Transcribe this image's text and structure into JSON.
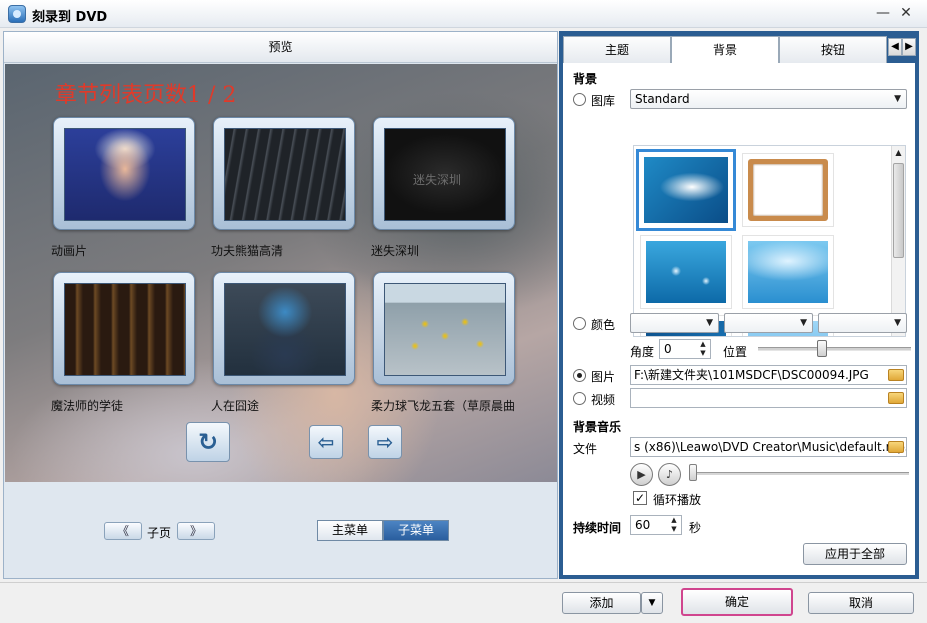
{
  "window": {
    "title": "刻录到 DVD",
    "minimize": "—",
    "close": "✕"
  },
  "preview": {
    "header": "预览",
    "chapter_title": "章节列表页数1 / 2",
    "watermark": "迷失深圳",
    "chapters": [
      {
        "label": "动画片"
      },
      {
        "label": "功夫熊猫高清"
      },
      {
        "label": "迷失深圳"
      },
      {
        "label": "魔法师的学徒"
      },
      {
        "label": "人在囧途"
      },
      {
        "label": "柔力球飞龙五套（草原晨曲"
      }
    ],
    "return_icon": "↻",
    "prev_icon": "⇦",
    "next_icon": "⇨"
  },
  "page_nav": {
    "prev": "《",
    "label": "子页",
    "next": "》"
  },
  "menu_switch": {
    "main": "主菜单",
    "sub": "子菜单"
  },
  "tabs": {
    "items": [
      "主题",
      "背景",
      "按钮"
    ],
    "active": "背景",
    "scroll_left": "◀",
    "scroll_right": "▶"
  },
  "background": {
    "section_title": "背景",
    "library_label": "图库",
    "library_value": "Standard",
    "color_label": "颜色",
    "angle_label": "角度",
    "angle_value": "0",
    "position_label": "位置",
    "position_value": 0.42,
    "image_label": "图片",
    "image_path": "F:\\新建文件夹\\101MSDCF\\DSC00094.JPG",
    "video_label": "视频",
    "video_path": ""
  },
  "music": {
    "section_title": "背景音乐",
    "file_label": "文件",
    "file_path": "s (x86)\\Leawo\\DVD Creator\\Music\\default.mp3",
    "play_icon": "▶",
    "note_icon": "♪",
    "loop_label": "循环播放",
    "loop_checked": true,
    "check_mark": "✓"
  },
  "duration": {
    "label": "持续时间",
    "value": "60",
    "unit": "秒"
  },
  "apply_all": "应用于全部",
  "footer": {
    "add": "添加",
    "add_arrow": "▼",
    "ok": "确定",
    "cancel": "取消"
  },
  "colors": {
    "accent": "#2b5d92",
    "chapter_title": "#e03a2a",
    "ok_highlight": "#d0458e",
    "selection": "#3589d6"
  }
}
